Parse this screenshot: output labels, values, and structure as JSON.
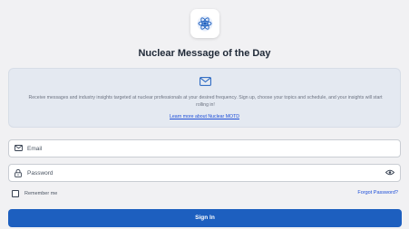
{
  "header": {
    "logo_icon": "atom-icon",
    "title": "Nuclear Message of the Day"
  },
  "info_card": {
    "icon": "envelope-icon",
    "description": "Receive messages and industry insights targeted at nuclear professionals at your desired frequency. Sign up, choose your topics and schedule, and your insights will start rolling in!",
    "link_label": "Learn more about Nuclear MOTD"
  },
  "form": {
    "email": {
      "icon": "envelope-icon",
      "placeholder": "Email",
      "value": ""
    },
    "password": {
      "icon": "lock-icon",
      "placeholder": "Password",
      "value": "",
      "toggle_icon": "eye-icon"
    },
    "remember_label": "Remember me",
    "remember_checked": false,
    "forgot_label": "Forgot Password?",
    "submit_label": "Sign In"
  },
  "colors": {
    "accent": "#1d5fbf",
    "link": "#1d4ed8",
    "card_bg": "#e4e9f1",
    "page_bg": "#f1f1f3"
  }
}
